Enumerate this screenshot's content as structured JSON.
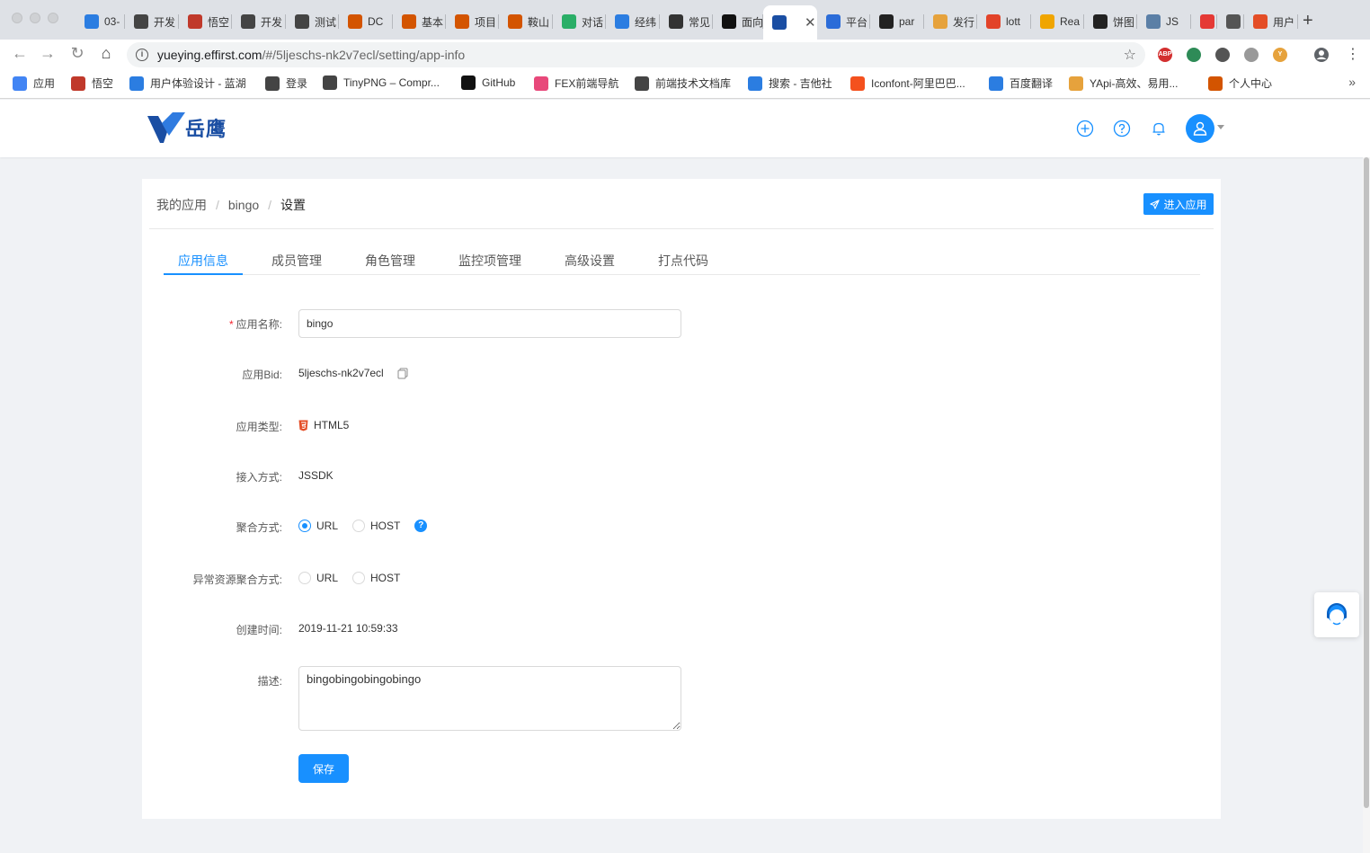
{
  "browser": {
    "tabs": [
      {
        "label": "03-",
        "icon": "qq-icon",
        "color": "#2b7de1"
      },
      {
        "label": "开发",
        "icon": "globe-icon",
        "color": "#444444"
      },
      {
        "label": "悟空",
        "icon": "monkey-icon",
        "color": "#c0392b"
      },
      {
        "label": "开发",
        "icon": "globe-icon",
        "color": "#444444"
      },
      {
        "label": "测试",
        "icon": "globe-icon",
        "color": "#444444"
      },
      {
        "label": "DC",
        "icon": "m-icon",
        "color": "#d35400"
      },
      {
        "label": "基本",
        "icon": "m-icon",
        "color": "#d35400"
      },
      {
        "label": "项目",
        "icon": "m-icon",
        "color": "#d35400"
      },
      {
        "label": "鞍山",
        "icon": "m-icon",
        "color": "#d35400"
      },
      {
        "label": "对话",
        "icon": "wechat-icon",
        "color": "#2aae67"
      },
      {
        "label": "经纬",
        "icon": "qq-icon",
        "color": "#2b7de1"
      },
      {
        "label": "常见",
        "icon": "chart-icon",
        "color": "#333333"
      },
      {
        "label": "面向",
        "icon": "dark-circle-icon",
        "color": "#111111"
      },
      {
        "label": "",
        "icon": "yueying-icon",
        "color": "#1a4ea3",
        "active": true
      },
      {
        "label": "平台",
        "icon": "brush-icon",
        "color": "#2b6cd8"
      },
      {
        "label": "par",
        "icon": "codepen-icon",
        "color": "#222222"
      },
      {
        "label": "发行",
        "icon": "yapi-icon",
        "color": "#e6a23c"
      },
      {
        "label": "lott",
        "icon": "gitlab-icon",
        "color": "#e24329"
      },
      {
        "label": "Rea",
        "icon": "react-icon",
        "color": "#f0a500"
      },
      {
        "label": "饼图",
        "icon": "codepen-icon",
        "color": "#222222"
      },
      {
        "label": "JS",
        "icon": "js-icon",
        "color": "#5b7fa6"
      },
      {
        "label": "",
        "icon": "listen-icon",
        "color": "#e53935"
      },
      {
        "label": "",
        "icon": "speaker-icon",
        "color": "#555555"
      },
      {
        "label": "用户",
        "icon": "html5-icon",
        "color": "#e44d26"
      }
    ],
    "active_tab_close": "✕",
    "new_tab": "+",
    "url": {
      "host": "yueying.effirst.com",
      "path": "/#/5ljeschs-nk2v7ecl/setting/app-info"
    },
    "extensions": [
      {
        "icon": "abp-icon",
        "text": "ABP",
        "color": "#d32f2f"
      },
      {
        "icon": "vue-icon",
        "text": "",
        "color": "#2e8b57"
      },
      {
        "icon": "evernote-icon",
        "text": "",
        "color": "#555555"
      },
      {
        "icon": "folder-icon",
        "text": "",
        "color": "#999999"
      },
      {
        "icon": "yapi-ext-icon",
        "text": "Y",
        "color": "#e6a23c"
      }
    ],
    "bookmarks": [
      {
        "label": "应用",
        "icon": "apps-grid-icon",
        "color": "#4285f4"
      },
      {
        "label": "悟空",
        "icon": "monkey-icon",
        "color": "#c0392b"
      },
      {
        "label": "用户体验设计 - 蓝湖",
        "icon": "lanhu-icon",
        "color": "#2b7de1"
      },
      {
        "label": "登录",
        "icon": "globe-icon",
        "color": "#444444"
      },
      {
        "label": "TinyPNG – Compr...",
        "icon": "panda-icon",
        "color": "#444444"
      },
      {
        "label": "GitHub",
        "icon": "github-icon",
        "color": "#111111"
      },
      {
        "label": "FEX前端导航",
        "icon": "fex-icon",
        "color": "#e8487a"
      },
      {
        "label": "前端技术文档库",
        "icon": "globe-icon",
        "color": "#444444"
      },
      {
        "label": "搜索 - 吉他社",
        "icon": "jitashe-icon",
        "color": "#2b7de1"
      },
      {
        "label": "Iconfont-阿里巴巴...",
        "icon": "iconfont-icon",
        "color": "#f4511e"
      },
      {
        "label": "百度翻译",
        "icon": "baidu-translate-icon",
        "color": "#2b7de1"
      },
      {
        "label": "YApi-高效、易用...",
        "icon": "yapi-icon",
        "color": "#e6a23c"
      },
      {
        "label": "个人中心",
        "icon": "m-icon",
        "color": "#d35400"
      }
    ],
    "bookmarks_more": "»"
  },
  "app": {
    "logo_text": "岳鹰",
    "breadcrumb": [
      "我的应用",
      "bingo",
      "设置"
    ],
    "enter_button": "进入应用",
    "tabs": [
      "应用信息",
      "成员管理",
      "角色管理",
      "监控项管理",
      "高级设置",
      "打点代码"
    ],
    "active_tab": 0,
    "form": {
      "name": {
        "label": "应用名称:",
        "value": "bingo"
      },
      "bid": {
        "label": "应用Bid:",
        "value": "5ljeschs-nk2v7ecl"
      },
      "type": {
        "label": "应用类型:",
        "value": "HTML5"
      },
      "access": {
        "label": "接入方式:",
        "value": "JSSDK"
      },
      "aggregation": {
        "label": "聚合方式:",
        "options": [
          "URL",
          "HOST"
        ],
        "selected": "URL"
      },
      "error_aggregation": {
        "label": "异常资源聚合方式:",
        "options": [
          "URL",
          "HOST"
        ],
        "selected": ""
      },
      "created": {
        "label": "创建时间:",
        "value": "2019-11-21 10:59:33"
      },
      "description": {
        "label": "描述:",
        "value": "bingobingobingobingo"
      },
      "save_button": "保存"
    }
  },
  "colors": {
    "primary": "#1890ff",
    "brand": "#1a4ea3",
    "required": "#f5222d"
  }
}
